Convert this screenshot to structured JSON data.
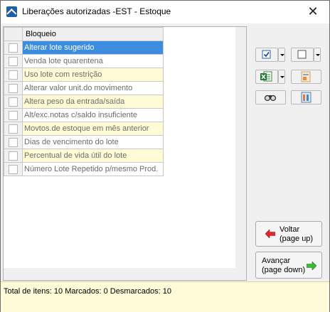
{
  "window": {
    "title": "Liberações autorizadas -EST - Estoque",
    "close_glyph": "✕"
  },
  "grid": {
    "column_header": "Bloqueio",
    "rows": [
      {
        "label": "Alterar lote sugerido",
        "style": "sel"
      },
      {
        "label": "Venda lote quarentena",
        "style": "white"
      },
      {
        "label": "Uso lote com restrição",
        "style": "yellow"
      },
      {
        "label": "Alterar valor unit.do movimento",
        "style": "white"
      },
      {
        "label": "Altera peso da entrada/saída",
        "style": "yellow"
      },
      {
        "label": "Alt/exc.notas c/saldo insuficiente",
        "style": "white"
      },
      {
        "label": "Movtos.de estoque em mês anterior",
        "style": "yellow"
      },
      {
        "label": "Dias de vencimento do lote",
        "style": "white"
      },
      {
        "label": "Percentual de vida útil do lote",
        "style": "yellow"
      },
      {
        "label": "Número Lote Repetido p/mesmo Prod.",
        "style": "white"
      }
    ]
  },
  "toolbar": {
    "check_all_icon": "checked-checkbox-icon",
    "uncheck_all_icon": "empty-checkbox-icon",
    "excel_icon": "excel-icon",
    "report_icon": "report-icon",
    "find_icon": "binoculars-icon",
    "columns_icon": "columns-icon"
  },
  "buttons": {
    "back_line1": "Voltar",
    "back_line2": "(page up)",
    "next_line1": "Avançar",
    "next_line2": "(page down)"
  },
  "status": {
    "text": "Total de itens: 10 Marcados: 0 Desmarcados: 10"
  },
  "colors": {
    "selected_row": "#3c8de0",
    "alt_row": "#fffbd6",
    "status_bg": "#fdfbd8"
  }
}
